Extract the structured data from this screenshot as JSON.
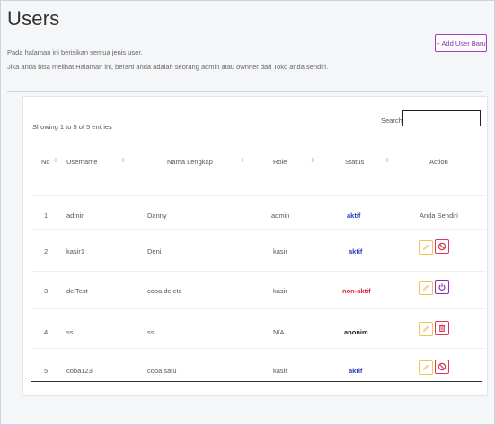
{
  "page": {
    "title": "Users",
    "desc1": "Pada halaman ini berisikan semua jenis user.",
    "desc2": "Jika anda bisa melihat Halaman ini, berarti anda adalah seorang admin atau ownner dari Toko anda sendiri.",
    "add_label": "+ Add User Baru"
  },
  "table": {
    "showing": "Showing 1 to 5 of 5 entries",
    "search_label": "Search:",
    "search_value": "",
    "headers": {
      "no": "No",
      "username": "Username",
      "nama": "Nama Lengkap",
      "role": "Role",
      "status": "Status",
      "action": "Action"
    },
    "rows": [
      {
        "no": "1",
        "username": "admin",
        "nama": "Danny",
        "role": "admin",
        "status": "aktif",
        "action": "Anda Sendiri"
      },
      {
        "no": "2",
        "username": "kasir1",
        "nama": "Deni",
        "role": "kasir",
        "status": "aktif"
      },
      {
        "no": "3",
        "username": "delTest",
        "nama": "coba delete",
        "role": "kasir",
        "status": "non-aktif"
      },
      {
        "no": "4",
        "username": "ss",
        "nama": "ss",
        "role": "N/A",
        "status": "anonim"
      },
      {
        "no": "5",
        "username": "coba123",
        "nama": "coba satu",
        "role": "kasir",
        "status": "aktif"
      }
    ]
  },
  "colors": {
    "aktif": "#2a3bbf",
    "non_aktif": "#d4252e",
    "anonim": "#222222",
    "accent": "#a23cc4",
    "edit": "#f1c25a",
    "danger": "#d33a56",
    "power": "#8a2db0"
  },
  "icons": {
    "edit": "pencil-icon",
    "ban": "ban-icon",
    "power": "power-icon",
    "trash": "trash-icon"
  }
}
